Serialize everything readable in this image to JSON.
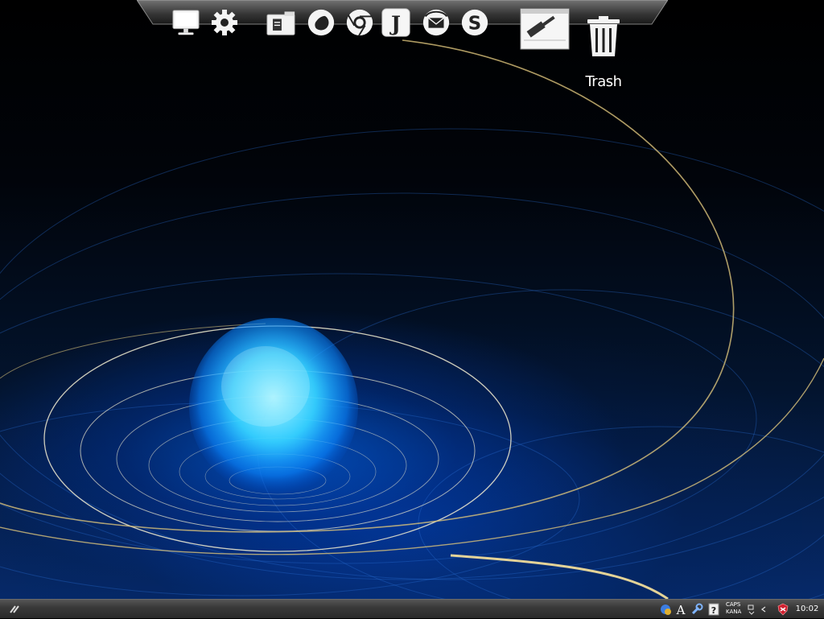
{
  "desktop": {
    "wallpaper": "blue-orb-swirl-wallpaper",
    "colors": {
      "orb": "#4fd8ff",
      "glow": "#0a6cff",
      "ring": "#e8d9a0",
      "background": "#000000"
    },
    "trash": {
      "label": "Trash",
      "icon": "trash-icon"
    }
  },
  "dock": {
    "items": [
      {
        "name": "computer",
        "icon": "monitor-icon"
      },
      {
        "name": "settings",
        "icon": "gear-icon"
      },
      {
        "name": "files",
        "icon": "folder-icon"
      },
      {
        "name": "firefox",
        "icon": "firefox-icon"
      },
      {
        "name": "chrome",
        "icon": "chrome-icon"
      },
      {
        "name": "j-app",
        "icon": "j-letter-icon"
      },
      {
        "name": "thunderbird",
        "icon": "thunderbird-icon"
      },
      {
        "name": "skype",
        "icon": "skype-icon"
      },
      {
        "name": "build-tool",
        "icon": "hammer-icon"
      }
    ]
  },
  "taskbar": {
    "start": {
      "icon": "start-icon"
    },
    "tray": {
      "icons": [
        "network-icon",
        "font-icon",
        "wrench-icon",
        "help-icon",
        "language-bar-icon",
        "collapse-chevron-icon",
        "shield-icon"
      ],
      "caps": "CAPS",
      "kana": "KANA"
    },
    "clock": "10:02"
  }
}
